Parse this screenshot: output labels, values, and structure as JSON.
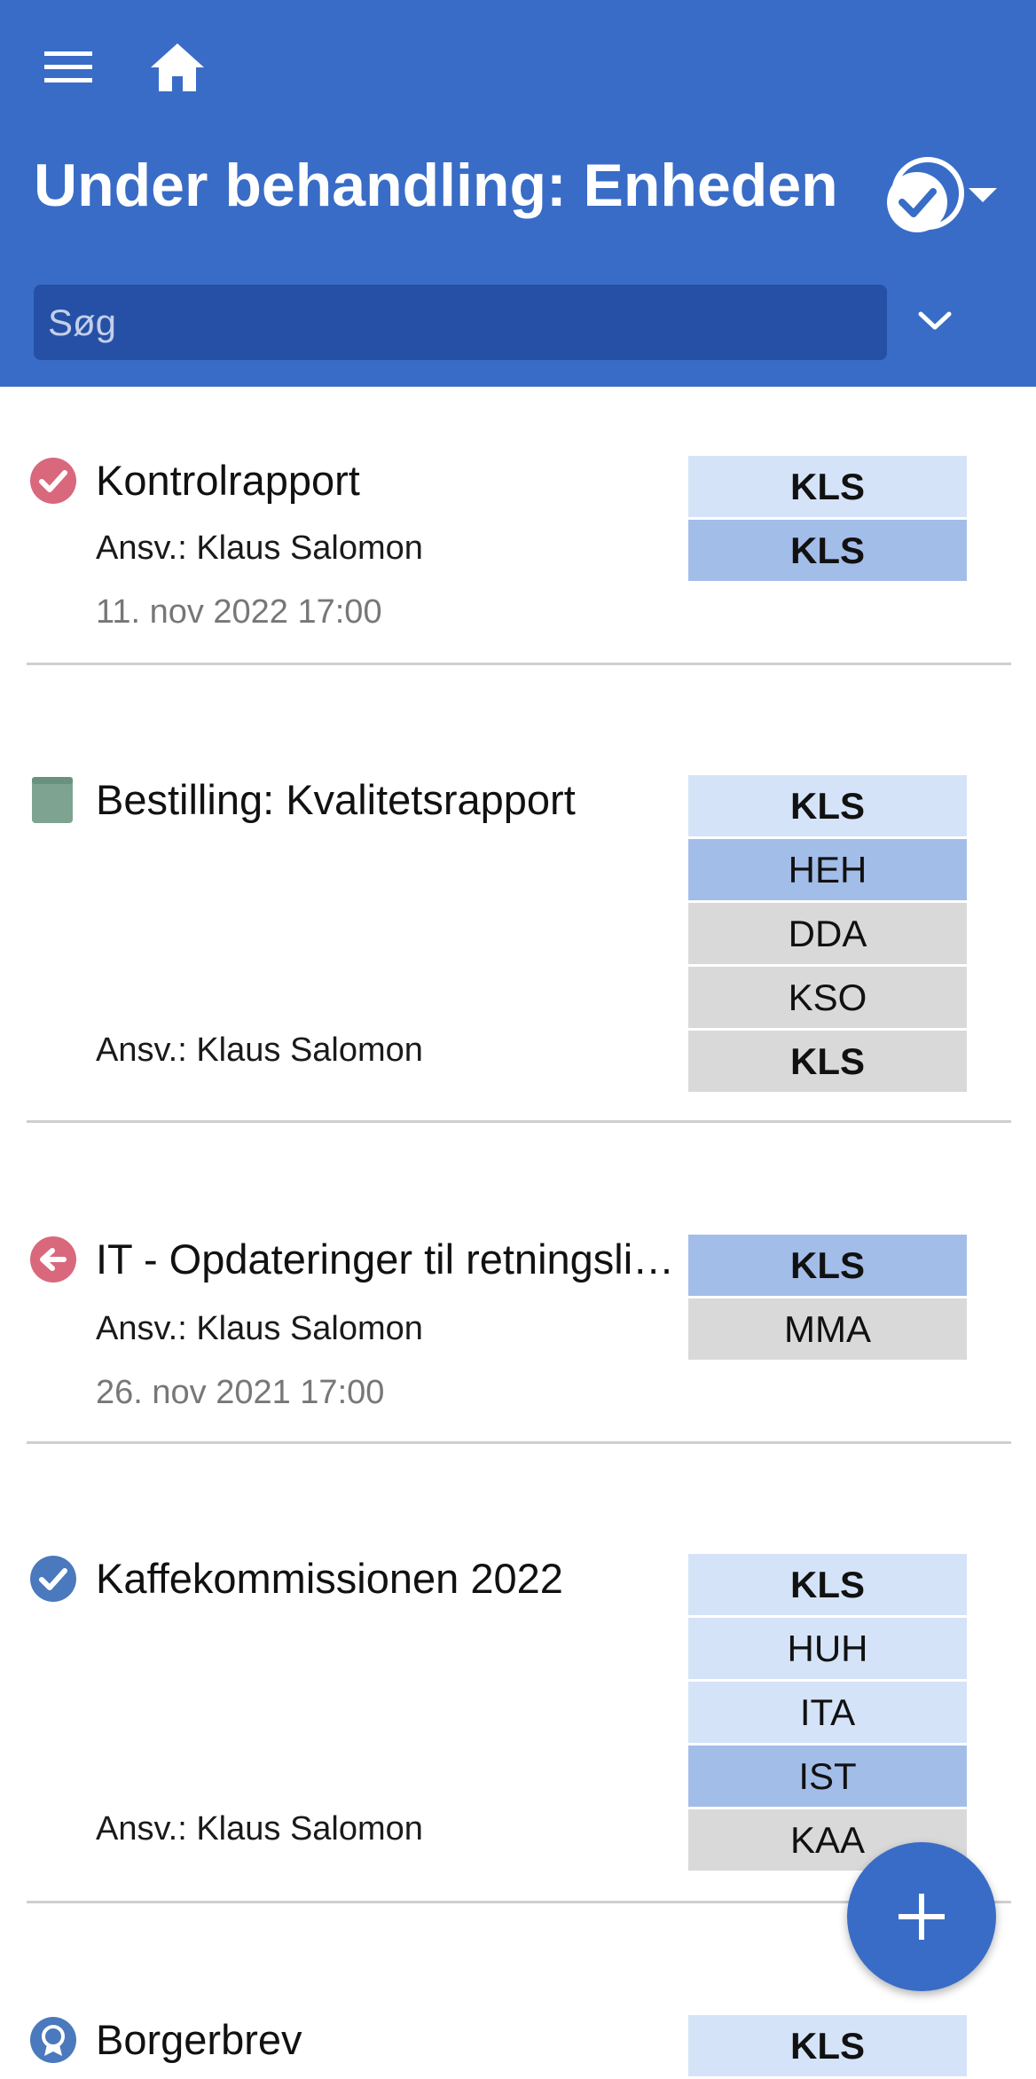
{
  "header": {
    "title": "Under behandling: Enheden",
    "search": {
      "placeholder": "Søg"
    },
    "icons": {
      "menu": "menu-icon",
      "home": "home-icon",
      "status": "check-circle-icon",
      "dropdown": "caret-down-icon",
      "expand": "chevron-down-icon"
    },
    "color": "#396cc6"
  },
  "items": [
    {
      "status_icon": "check-circle-icon",
      "status_color": "#d9687d",
      "title": "Kontrolrapport",
      "responsible": "Ansv.: Klaus Salomon",
      "date": "11. nov 2022 17:00",
      "tags": [
        {
          "label": "KLS",
          "style": "light",
          "bold": true
        },
        {
          "label": "KLS",
          "style": "mid",
          "bold": true
        }
      ]
    },
    {
      "status_icon": "book-icon",
      "status_color": "#7ea390",
      "title": "Bestilling: Kvalitetsrapport",
      "responsible": "Ansv.: Klaus Salomon",
      "tags": [
        {
          "label": "KLS",
          "style": "light",
          "bold": true
        },
        {
          "label": "HEH",
          "style": "mid"
        },
        {
          "label": "DDA",
          "style": "gray"
        },
        {
          "label": "KSO",
          "style": "gray"
        },
        {
          "label": "KLS",
          "style": "gray",
          "bold": true
        }
      ]
    },
    {
      "status_icon": "arrow-left-circle-icon",
      "status_color": "#d9687d",
      "title": "IT - Opdateringer til retningslinjer",
      "responsible": "Ansv.: Klaus Salomon",
      "date": "26. nov 2021 17:00",
      "tags": [
        {
          "label": "KLS",
          "style": "mid",
          "bold": true
        },
        {
          "label": "MMA",
          "style": "gray"
        }
      ]
    },
    {
      "status_icon": "check-circle-icon",
      "status_color": "#4a79bd",
      "title": "Kaffekommissionen 2022",
      "responsible": "Ansv.: Klaus Salomon",
      "tags": [
        {
          "label": "KLS",
          "style": "light",
          "bold": true
        },
        {
          "label": "HUH",
          "style": "light"
        },
        {
          "label": "ITA",
          "style": "light"
        },
        {
          "label": "IST",
          "style": "mid"
        },
        {
          "label": "KAA",
          "style": "gray"
        }
      ]
    },
    {
      "status_icon": "award-icon",
      "status_color": "#4a79bd",
      "title": "Borgerbrev",
      "tags": [
        {
          "label": "KLS",
          "style": "light",
          "bold": true
        }
      ]
    }
  ],
  "fab": {
    "icon": "plus-icon"
  }
}
